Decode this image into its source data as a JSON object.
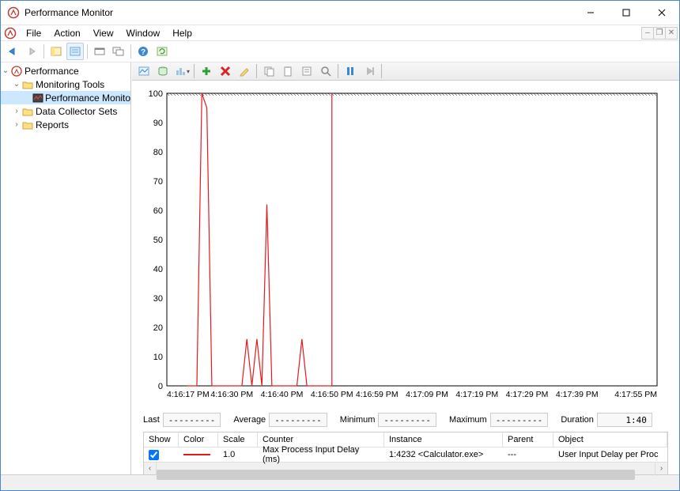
{
  "window": {
    "title": "Performance Monitor"
  },
  "menu": {
    "file": "File",
    "action": "Action",
    "view": "View",
    "window": "Window",
    "help": "Help"
  },
  "tree": {
    "root": "Performance",
    "monitoring_tools": "Monitoring Tools",
    "performance_monitor": "Performance Monitor",
    "data_collector_sets": "Data Collector Sets",
    "reports": "Reports"
  },
  "stats": {
    "last_label": "Last",
    "average_label": "Average",
    "minimum_label": "Minimum",
    "maximum_label": "Maximum",
    "duration_label": "Duration",
    "last_value": "---------",
    "average_value": "---------",
    "minimum_value": "---------",
    "maximum_value": "---------",
    "duration_value": "1:40"
  },
  "legend": {
    "headers": {
      "show": "Show",
      "color": "Color",
      "scale": "Scale",
      "counter": "Counter",
      "instance": "Instance",
      "parent": "Parent",
      "object": "Object"
    },
    "row": {
      "show_checked": true,
      "color": "#e41a1c",
      "scale": "1.0",
      "counter": "Max Process Input Delay (ms)",
      "instance": "1:4232 <Calculator.exe>",
      "parent": "---",
      "object": "User Input Delay per Proc"
    }
  },
  "chart_data": {
    "type": "line",
    "ylim": [
      0,
      100
    ],
    "yticks": [
      0,
      10,
      20,
      30,
      40,
      50,
      60,
      70,
      80,
      90,
      100
    ],
    "x_start": "4:16:17 PM",
    "x_end": "4:17:55 PM",
    "xticks": [
      "4:16:17 PM",
      "4:16:30 PM",
      "4:16:40 PM",
      "4:16:50 PM",
      "4:16:59 PM",
      "4:17:09 PM",
      "4:17:19 PM",
      "4:17:29 PM",
      "4:17:39 PM",
      "4:17:55 PM"
    ],
    "cursor_x": "4:16:50 PM",
    "series": [
      {
        "name": "Max Process Input Delay (ms)",
        "color": "#e41a1c",
        "points": [
          {
            "x": "4:16:21",
            "y": 0
          },
          {
            "x": "4:16:23",
            "y": 0
          },
          {
            "x": "4:16:24",
            "y": 100
          },
          {
            "x": "4:16:25",
            "y": 95
          },
          {
            "x": "4:16:26",
            "y": 0
          },
          {
            "x": "4:16:32",
            "y": 0
          },
          {
            "x": "4:16:33",
            "y": 16
          },
          {
            "x": "4:16:34",
            "y": 0
          },
          {
            "x": "4:16:35",
            "y": 16
          },
          {
            "x": "4:16:36",
            "y": 0
          },
          {
            "x": "4:16:37",
            "y": 62
          },
          {
            "x": "4:16:38",
            "y": 0
          },
          {
            "x": "4:16:43",
            "y": 0
          },
          {
            "x": "4:16:44",
            "y": 16
          },
          {
            "x": "4:16:45",
            "y": 0
          },
          {
            "x": "4:16:50",
            "y": 0
          }
        ]
      }
    ]
  }
}
